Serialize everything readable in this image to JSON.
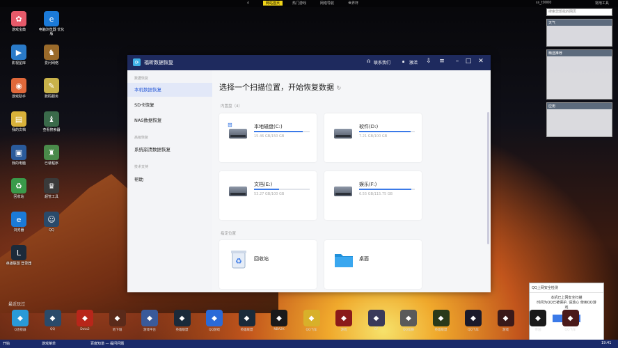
{
  "topbar": {
    "items": [
      "网站首页",
      "热门游戏",
      "网络导航",
      "世界杯"
    ],
    "user": "ss_t0000",
    "right": "常用工具"
  },
  "desktop_icons": [
    {
      "label": "游戏宝典",
      "color": "#e65a6a",
      "glyph": "✿"
    },
    {
      "label": "电脑浏览器 优化版",
      "color": "#1b7ad8",
      "glyph": "e"
    },
    {
      "label": "影视星库",
      "color": "#2a7ac8",
      "glyph": "▶"
    },
    {
      "label": "爱问网络",
      "color": "#9a6a2a",
      "glyph": "♞"
    },
    {
      "label": "游戏助手",
      "color": "#e0683a",
      "glyph": "◉"
    },
    {
      "label": "数码服务",
      "color": "#c8b24a",
      "glyph": "✎"
    },
    {
      "label": "我的文档",
      "color": "#d9b13a",
      "glyph": "▤"
    },
    {
      "label": "查看搜索器",
      "color": "#3a6a4a",
      "glyph": "♝"
    },
    {
      "label": "我的电脑",
      "color": "#2a5a9a",
      "glyph": "▣"
    },
    {
      "label": "已装程序",
      "color": "#4a8a4a",
      "glyph": "♜"
    },
    {
      "label": "回收站",
      "color": "#3a9a4a",
      "glyph": "♻"
    },
    {
      "label": "超管工具",
      "color": "#3a3a3a",
      "glyph": "♛"
    },
    {
      "label": "浏览器",
      "color": "#1b7ad8",
      "glyph": "e"
    },
    {
      "label": "QQ",
      "color": "#2a4a6a",
      "glyph": "☺"
    },
    {
      "label": "英雄联盟 登录器",
      "color": "#1c2a3a",
      "glyph": "L"
    }
  ],
  "taskbar_title": "最近玩过",
  "dock": [
    "Q连接器",
    "QQ",
    "Dota2",
    "地下城",
    "游戏平台",
    "英雄联盟",
    "QQ游戏",
    "英雄联盟",
    "NBA2K",
    "QQ飞车",
    "游戏",
    "CF",
    "QQ炫舞",
    "英雄联盟",
    "QQ飞车",
    "游戏",
    "帝国",
    "QQ飞车"
  ],
  "osbar": {
    "start": "开始",
    "task1": "游戏菜单",
    "task2": "百度知道 — 提问问题",
    "time": "19:41"
  },
  "widgets": {
    "search_placeholder": "搜索您想找的网页",
    "weather_title": "天气",
    "news_title": "精选推荐",
    "apps_title": "应用"
  },
  "notice": {
    "title": "QQ上网安全检测",
    "line1": "本机已上网安全扫描",
    "line2": "时间为QQ已被保护, 请放心 使用QQ游戏",
    "button": "详情"
  },
  "window": {
    "title": "福昕数据恢复",
    "contact": "联系我们",
    "activate": "激活",
    "sidebar": {
      "sec1": "数据恢复",
      "items1": [
        "本机数据恢复",
        "SD卡恢复",
        "NAS数据恢复"
      ],
      "sec2": "高级恢复",
      "items2": [
        "系统崩溃数据恢复"
      ],
      "sec3": "技术支持",
      "items3": [
        "帮助"
      ]
    },
    "heading": "选择一个扫描位置，开始恢复数据",
    "section_disks": "内置盘（4）",
    "section_locations": "指定位置",
    "disks": [
      {
        "name": "本地磁盘(C:)",
        "used": "15.46 GB/150 GB",
        "fill": 0.88,
        "system": true
      },
      {
        "name": "软件(D:)",
        "used": "7.21 GB/100 GB",
        "fill": 0.92,
        "system": false
      },
      {
        "name": "文档(E:)",
        "used": "53.27 GB/100 GB",
        "fill": 0.45,
        "system": false
      },
      {
        "name": "娱乐(F:)",
        "used": "6.55 GB/115.75 GB",
        "fill": 0.94,
        "system": false
      }
    ],
    "locations": [
      {
        "name": "回收站",
        "icon": "recycle-bin-icon"
      },
      {
        "name": "桌面",
        "icon": "folder-icon"
      }
    ],
    "accent": "#3b7ae8"
  }
}
